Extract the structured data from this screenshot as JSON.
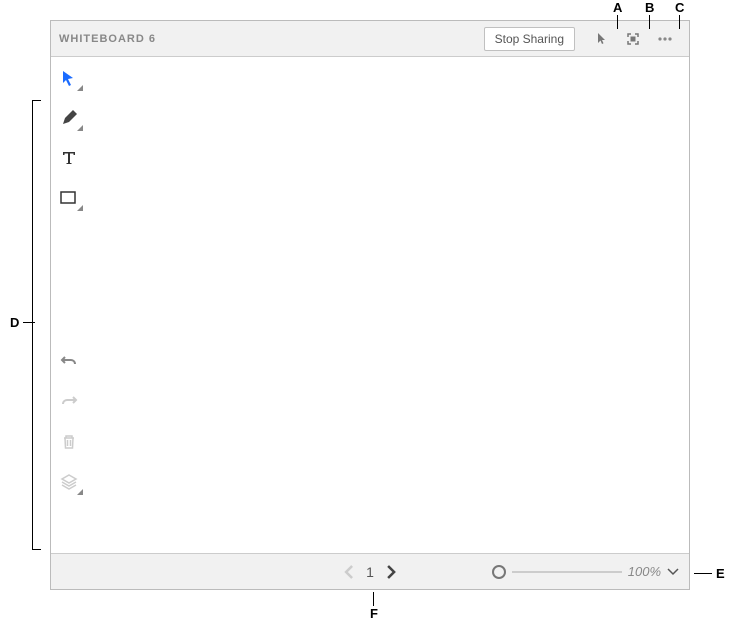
{
  "header": {
    "title": "WHITEBOARD 6",
    "stop_label": "Stop Sharing",
    "icons": {
      "pointer": "pointer-icon",
      "fullscreen": "fullscreen-icon",
      "more": "more-options-icon"
    }
  },
  "toolbar": {
    "tools": [
      {
        "name": "select-tool",
        "icon": "cursor-icon",
        "color": "#1a6bff"
      },
      {
        "name": "pen-tool",
        "icon": "pencil-icon",
        "color": "#444"
      },
      {
        "name": "text-tool",
        "icon": "text-icon",
        "color": "#333"
      },
      {
        "name": "shape-tool",
        "icon": "rectangle-icon",
        "color": "#333"
      }
    ],
    "actions": [
      {
        "name": "undo",
        "icon": "undo-icon",
        "enabled": true
      },
      {
        "name": "redo",
        "icon": "redo-icon",
        "enabled": false
      },
      {
        "name": "delete",
        "icon": "trash-icon",
        "enabled": false
      },
      {
        "name": "layers",
        "icon": "layers-icon",
        "enabled": false
      }
    ]
  },
  "footer": {
    "page": "1",
    "zoom": "100%"
  },
  "labels": {
    "A": "A",
    "B": "B",
    "C": "C",
    "D": "D",
    "E": "E",
    "F": "F"
  }
}
